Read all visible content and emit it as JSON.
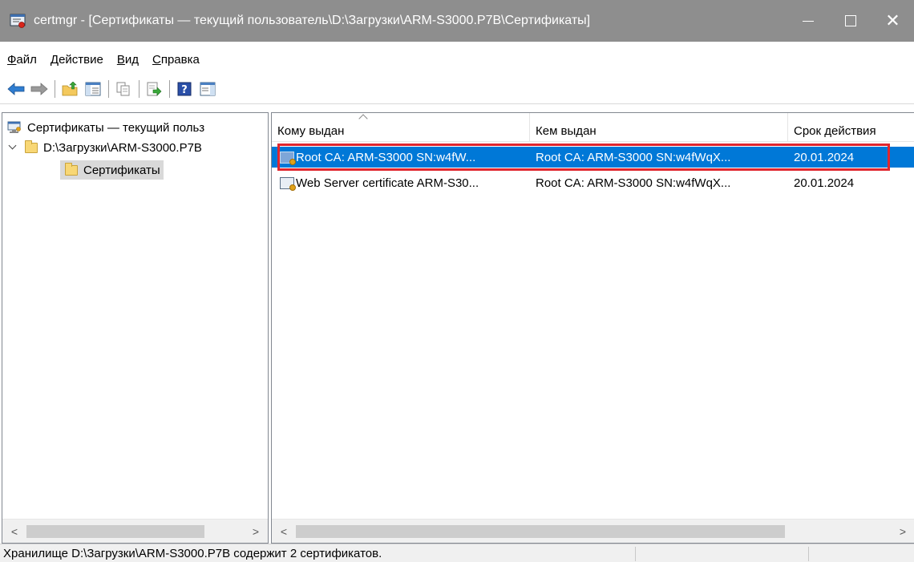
{
  "window": {
    "title": "certmgr - [Сертификаты — текущий пользователь\\D:\\Загрузки\\ARM-S3000.P7B\\Сертификаты]",
    "minimize_label": "—",
    "close_label": "✕"
  },
  "menu": [
    {
      "first": "Ф",
      "rest": "айл"
    },
    {
      "first": "Д",
      "rest": "ействие"
    },
    {
      "first": "В",
      "rest": "ид"
    },
    {
      "first": "С",
      "rest": "правка"
    }
  ],
  "tree": {
    "root_label": "Сертификаты — текущий польз",
    "file_label": "D:\\Загрузки\\ARM-S3000.P7B",
    "child_label": "Сертификаты"
  },
  "list": {
    "columns": [
      "Кому выдан",
      "Кем выдан",
      "Срок действия"
    ],
    "rows": [
      {
        "issued_to": "Root CA: ARM-S3000 SN:w4fW...",
        "issued_by": "Root CA: ARM-S3000 SN:w4fWqX...",
        "expires": "20.01.2024",
        "selected": true
      },
      {
        "issued_to": "Web Server certificate ARM-S30...",
        "issued_by": "Root CA: ARM-S3000 SN:w4fWqX...",
        "expires": "20.01.2024",
        "selected": false
      }
    ]
  },
  "status": {
    "text": "Хранилище D:\\Загрузки\\ARM-S3000.P7B содержит 2 сертификатов."
  },
  "colors": {
    "selection": "#0078d7",
    "highlight": "#e0262e",
    "titlebar": "#8e8e8e"
  }
}
